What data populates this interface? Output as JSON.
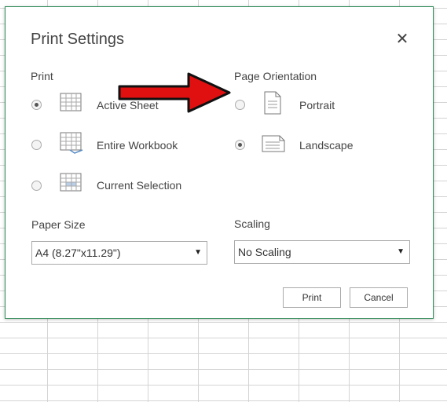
{
  "dialog": {
    "title": "Print Settings",
    "close_glyph": "✕"
  },
  "print": {
    "label": "Print",
    "options": [
      {
        "label": "Active Sheet",
        "selected": true,
        "icon": "active-sheet-icon"
      },
      {
        "label": "Entire Workbook",
        "selected": false,
        "icon": "entire-workbook-icon"
      },
      {
        "label": "Current Selection",
        "selected": false,
        "icon": "current-selection-icon"
      }
    ]
  },
  "orientation": {
    "label": "Page Orientation",
    "options": [
      {
        "label": "Portrait",
        "selected": false,
        "icon": "portrait-page-icon"
      },
      {
        "label": "Landscape",
        "selected": true,
        "icon": "landscape-page-icon"
      }
    ]
  },
  "paper_size": {
    "label": "Paper Size",
    "value": "A4 (8.27\"x11.29\")"
  },
  "scaling": {
    "label": "Scaling",
    "value": "No Scaling"
  },
  "buttons": {
    "print": "Print",
    "cancel": "Cancel"
  },
  "colors": {
    "dialog_border": "#2e8b57",
    "arrow": "#e11010"
  }
}
